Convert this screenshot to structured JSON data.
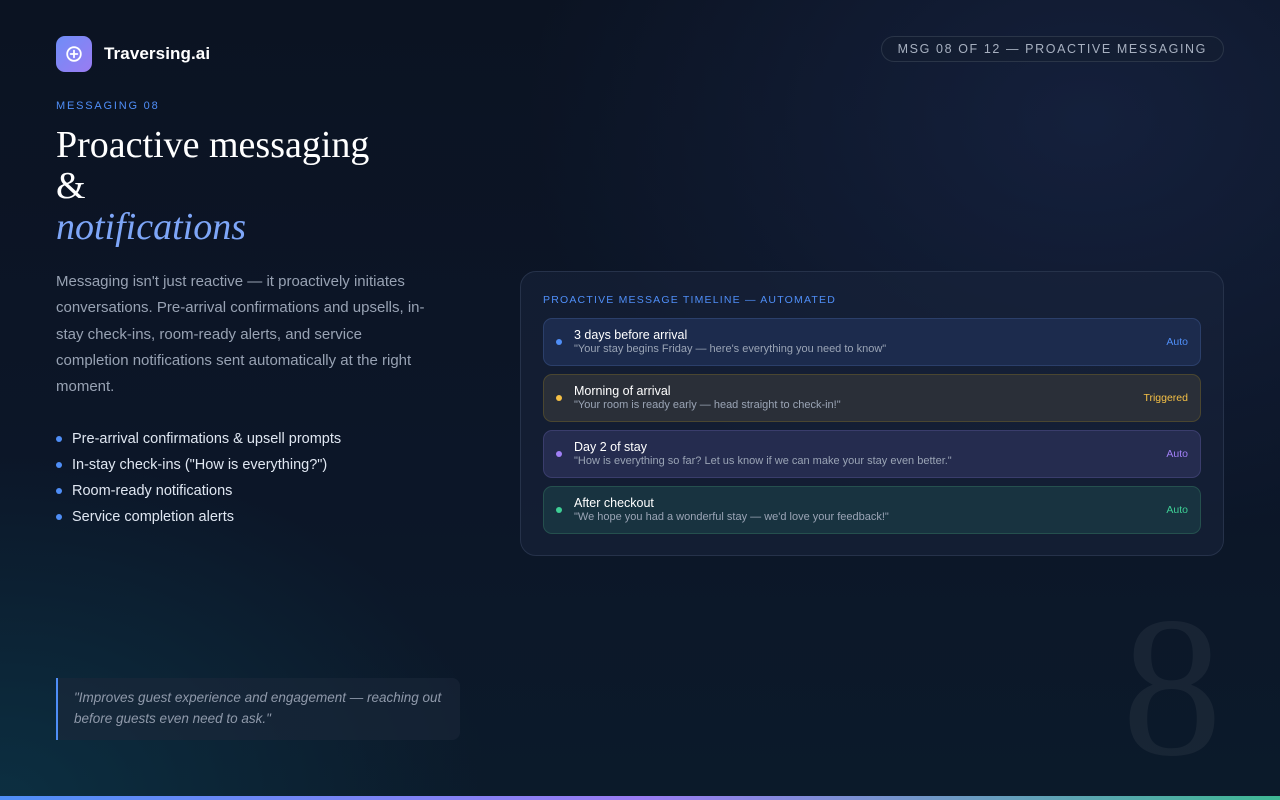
{
  "brand": {
    "name": "Traversing.ai",
    "icon": "plus-circle-icon"
  },
  "counter_pill": "MSG 08 OF 12 — PROACTIVE MESSAGING",
  "eyebrow": "MESSAGING 08",
  "title": {
    "line1": "Proactive messaging",
    "line2": "&",
    "accent": "notifications"
  },
  "description": "Messaging isn't just reactive — it proactively initiates conversations. Pre-arrival confirmations and upsells, in-stay check-ins, room-ready alerts, and service completion notifications sent automatically at the right moment.",
  "bullets": [
    "Pre-arrival confirmations & upsell prompts",
    "In-stay check-ins (\"How is everything?\")",
    "Room-ready notifications",
    "Service completion alerts"
  ],
  "quote": "\"Improves guest experience and engagement — reaching out before guests even need to ask.\"",
  "timeline": {
    "title": "PROACTIVE MESSAGE TIMELINE — AUTOMATED",
    "items": [
      {
        "label": "3 days before arrival",
        "message": "\"Your stay begins Friday — here's everything you need to know\"",
        "status": "Auto",
        "color": "#4f8ef7",
        "bg": "#1c2b4d",
        "border": "#2b3f6a"
      },
      {
        "label": "Morning of arrival",
        "message": "\"Your room is ready early — head straight to check-in!\"",
        "status": "Triggered",
        "color": "#f5c045",
        "bg": "#2a2f38",
        "border": "#4a4630"
      },
      {
        "label": "Day 2 of stay",
        "message": "\"How is everything so far? Let us know if we can make your stay even better.\"",
        "status": "Auto",
        "color": "#a07ff5",
        "bg": "#252c4f",
        "border": "#3a3d6c"
      },
      {
        "label": "After checkout",
        "message": "\"We hope you had a wonderful stay — we'd love your feedback!\"",
        "status": "Auto",
        "color": "#3ecf95",
        "bg": "#183340",
        "border": "#25504e"
      }
    ]
  },
  "big_number": "8",
  "colors": {
    "accent": "#4f8ef7",
    "accent_purple": "#9a7cf2",
    "accent_green": "#3fb894"
  }
}
